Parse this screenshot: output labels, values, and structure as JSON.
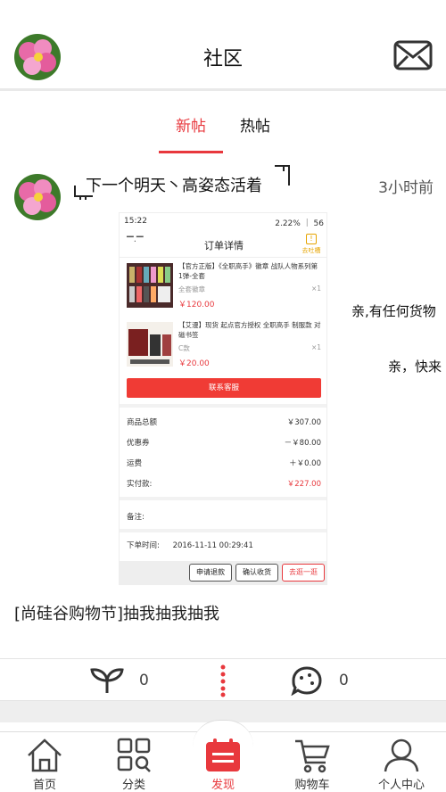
{
  "header": {
    "title": "社区"
  },
  "tabs": {
    "new_label": "新帖",
    "hot_label": "热帖"
  },
  "post": {
    "author": "下一个明天丶高姿态活着",
    "time": "3小时前",
    "text": "[尚硅谷购物节]抽我抽我抽我",
    "like_count": "0",
    "comment_count": "0",
    "overlay_lines": [
      "亲,有任何货物",
      "亲，快来"
    ]
  },
  "screenshot": {
    "status_left": "15:22",
    "status_right": "2.22% ｜ 56",
    "page_title": "订单详情",
    "tucao_label": "去吐槽",
    "items": [
      {
        "name": "【官方正版】《全职高手》徽章 战队人物系列第1弹-全套",
        "spec": "全套徽章",
        "qty": "×1",
        "price": "￥120.00"
      },
      {
        "name": "【艾漫】现货 起点官方授权 全职高手 制服款 对磁书签",
        "spec": "C款",
        "qty": "×1",
        "price": "￥20.00"
      }
    ],
    "contact_button": "联系客服",
    "summary": [
      {
        "label": "商品总额",
        "value": "￥307.00",
        "red": false
      },
      {
        "label": "优惠券",
        "value": "－￥80.00",
        "red": false
      },
      {
        "label": "运费",
        "value": "＋￥0.00",
        "red": false
      },
      {
        "label": "实付款:",
        "value": "￥227.00",
        "red": true
      }
    ],
    "remark_label": "备注:",
    "order_time_label": "下单时间:",
    "order_time": "2016-11-11 00:29:41",
    "buttons": [
      "申请退款",
      "确认收货",
      "去逛一逛"
    ]
  },
  "tabbar": {
    "items": [
      {
        "label": "首页",
        "icon": "home-icon"
      },
      {
        "label": "分类",
        "icon": "category-icon"
      },
      {
        "label": "发现",
        "icon": "discover-icon",
        "active": true
      },
      {
        "label": "购物车",
        "icon": "cart-icon"
      },
      {
        "label": "个人中心",
        "icon": "user-icon"
      }
    ]
  },
  "colors": {
    "accent": "#e8383d",
    "divider": "#e9e9e9"
  }
}
